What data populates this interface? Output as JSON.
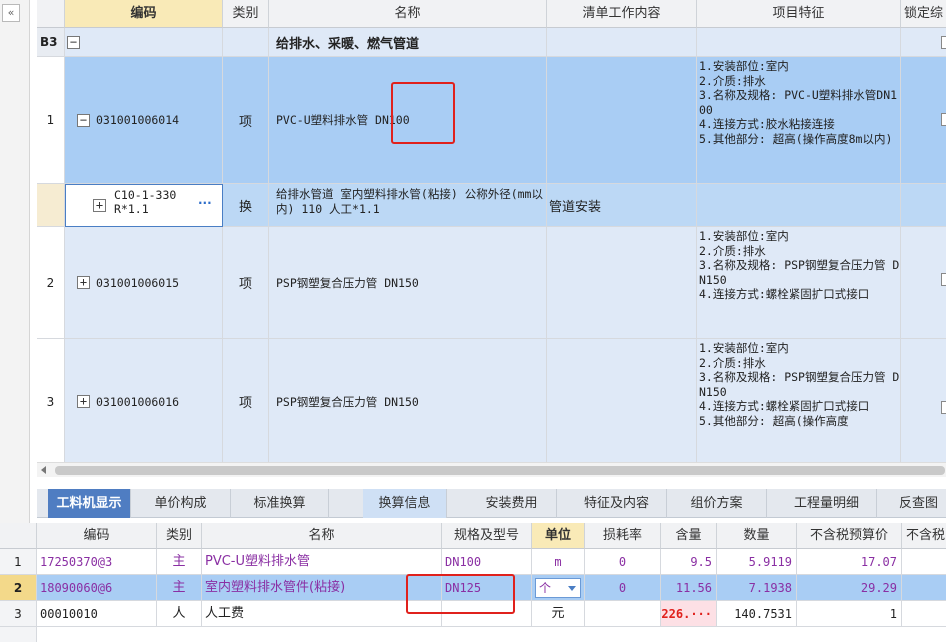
{
  "colors": {
    "selected_row": "#a9cdf4",
    "group_row": "#dfe9f7",
    "child_row": "#bcd8f5",
    "highlight_box": "#e0211c",
    "active_tab": "#4f7dc2",
    "material_text": "#8a2fa3",
    "header_bg": "#f1f2f4",
    "selected_header": "#f9eab7"
  },
  "left_strip": {
    "collapse_icon": "«"
  },
  "upper_grid": {
    "headers": {
      "code": "编码",
      "type": "类别",
      "name": "名称",
      "work": "清单工作内容",
      "feature": "项目特征",
      "lock": "锁定综"
    },
    "group": {
      "label": "B3",
      "toggle": "−",
      "name": "给排水、采暖、燃气管道"
    },
    "rows": [
      {
        "index": "1",
        "toggle": "−",
        "code": "031001006014",
        "type": "项",
        "name": "PVC-U塑料排水管 DN100",
        "work": "",
        "feature": "1.安装部位:室内\n2.介质:排水\n3.名称及规格: PVC-U塑料排水管DN100\n4.连接方式:胶水粘接连接\n5.其他部分: 超高(操作高度8m以内)"
      },
      {
        "index": "2",
        "toggle": "+",
        "code": "031001006015",
        "type": "项",
        "name": "PSP钢塑复合压力管 DN150",
        "work": "",
        "feature": "1.安装部位:室内\n2.介质:排水\n3.名称及规格: PSP钢塑复合压力管 DN150\n4.连接方式:螺栓紧固扩口式接口"
      },
      {
        "index": "3",
        "toggle": "+",
        "code": "031001006016",
        "type": "项",
        "name": "PSP钢塑复合压力管 DN150",
        "work": "",
        "feature": "1.安装部位:室内\n2.介质:排水\n3.名称及规格: PSP钢塑复合压力管 DN150\n4.连接方式:螺栓紧固扩口式接口\n5.其他部分: 超高(操作高度"
      }
    ],
    "child_row": {
      "toggle": "+",
      "code_line1": "C10-1-330",
      "code_line2": "R*1.1",
      "dots": "···",
      "type": "换",
      "name": "给排水管道 室内塑料排水管(粘接) 公称外径(mm以内) 110  人工*1.1",
      "work": "管道安装"
    }
  },
  "tabs": [
    "工料机显示",
    "单价构成",
    "标准换算",
    "换算信息",
    "安装费用",
    "特征及内容",
    "组价方案",
    "工程量明细",
    "反查图"
  ],
  "lower_grid": {
    "headers": {
      "code": "编码",
      "type": "类别",
      "name": "名称",
      "spec": "规格及型号",
      "unit": "单位",
      "loss": "损耗率",
      "content": "含量",
      "qty": "数量",
      "price": "不含税预算价",
      "extra": "不含税"
    },
    "rows": [
      {
        "index": "1",
        "code": "17250370@3",
        "type": "主",
        "name": "PVC-U塑料排水管",
        "spec": "DN100",
        "unit": "m",
        "loss": "0",
        "content": "9.5",
        "qty": "5.9119",
        "price": "17.07"
      },
      {
        "index": "2",
        "code": "18090060@6",
        "type": "主",
        "name": "室内塑料排水管件(粘接)",
        "spec": "DN125",
        "unit": "个",
        "loss": "0",
        "content": "11.56",
        "qty": "7.1938",
        "price": "29.29"
      },
      {
        "index": "3",
        "code": "00010010",
        "type": "人",
        "name": "人工费",
        "spec": "",
        "unit": "元",
        "loss": "",
        "content": "226.···",
        "qty": "140.7531",
        "price": "1"
      }
    ]
  }
}
